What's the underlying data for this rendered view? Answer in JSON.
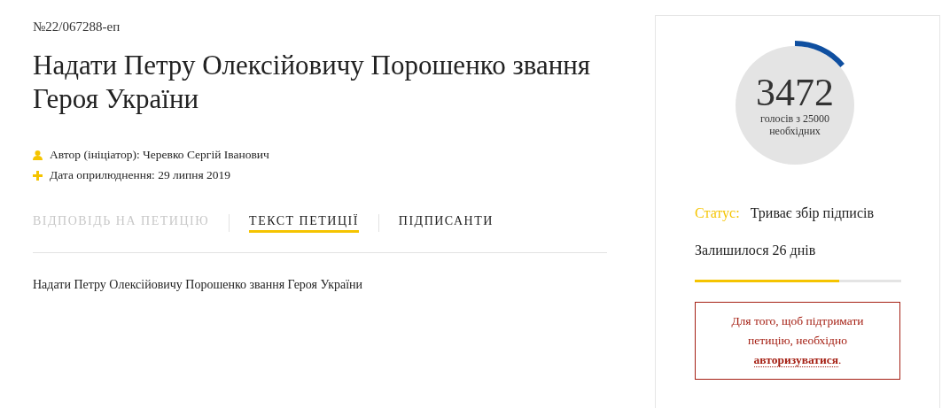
{
  "petition_number": "№22/067288-еп",
  "title": "Надати Петру Олексійовичу Порошенко звання Героя України",
  "meta": [
    {
      "kind": "author",
      "text": "Автор (ініціатор): Черевко Сергій Іванович"
    },
    {
      "kind": "date",
      "text": "Дата оприлюднення: 29 липня 2019"
    }
  ],
  "tabs": [
    {
      "label": "ВІДПОВІДЬ НА ПЕТИЦІЮ",
      "selected": false,
      "disabled": true
    },
    {
      "label": "ТЕКСТ ПЕТИЦІЇ",
      "selected": true,
      "disabled": false
    },
    {
      "label": "ПІДПИСАНТИ",
      "selected": false,
      "disabled": false
    }
  ],
  "body": "Надати Петру Олексійовичу Порошенко звання Героя України",
  "votes": {
    "count": "3472",
    "caption": "голосів з 25000 необхідних"
  },
  "status": {
    "label": "Статус:",
    "value": "Триває збір підписів"
  },
  "remaining": {
    "text": "Залишилося 26 днів",
    "level": 0.7
  },
  "notice": {
    "text": "Для того, щоб підтримати петицію, необхідно",
    "link": "авторизуватися",
    "end": "."
  }
}
